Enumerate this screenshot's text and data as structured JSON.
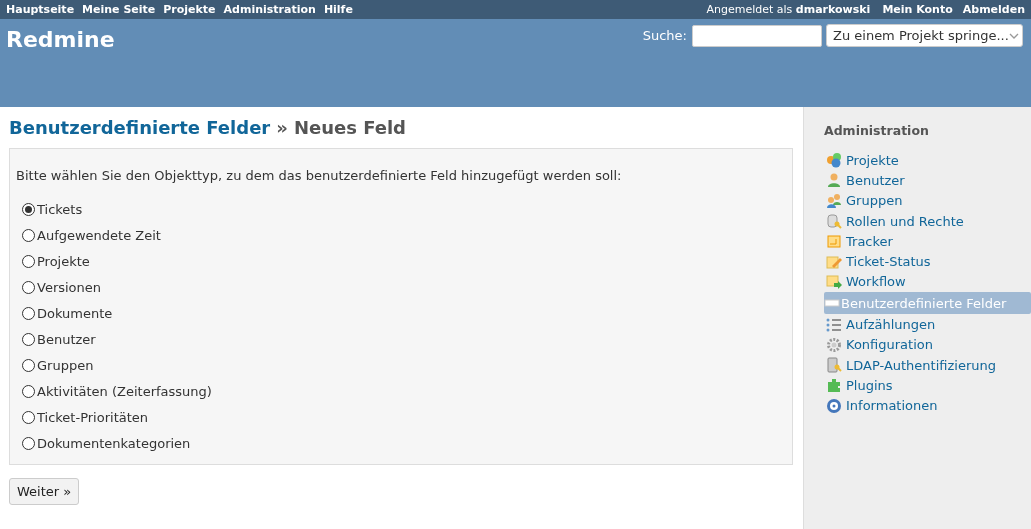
{
  "top_menu": {
    "items": [
      "Hauptseite",
      "Meine Seite",
      "Projekte",
      "Administration",
      "Hilfe"
    ],
    "logged_in": "Angemeldet als **dmarkowski**",
    "account_items": [
      "Mein Konto",
      "Abmelden"
    ]
  },
  "header": {
    "title": "Redmine",
    "search_label": "Suche:",
    "jump_placeholder": "Zu einem Projekt springe..."
  },
  "content": {
    "breadcrumb": "Benutzerdefinierte Felder",
    "separator": "»",
    "title": "Neues Feld",
    "instruction": "Bitte wählen Sie den Objekttyp, zu dem das benutzerdefinierte Feld hinzugefügt werden soll:",
    "options": [
      {
        "label": "Tickets",
        "selected": true
      },
      {
        "label": "Aufgewendete Zeit",
        "selected": false
      },
      {
        "label": "Projekte",
        "selected": false
      },
      {
        "label": "Versionen",
        "selected": false
      },
      {
        "label": "Dokumente",
        "selected": false
      },
      {
        "label": "Benutzer",
        "selected": false
      },
      {
        "label": "Gruppen",
        "selected": false
      },
      {
        "label": "Aktivitäten (Zeiterfassung)",
        "selected": false
      },
      {
        "label": "Ticket-Prioritäten",
        "selected": false
      },
      {
        "label": "Dokumentenkategorien",
        "selected": false
      }
    ],
    "button": "Weiter »"
  },
  "sidebar": {
    "title": "Administration",
    "items": [
      {
        "label": "Projekte",
        "selected": false
      },
      {
        "label": "Benutzer",
        "selected": false
      },
      {
        "label": "Gruppen",
        "selected": false
      },
      {
        "label": "Rollen und Rechte",
        "selected": false
      },
      {
        "label": "Tracker",
        "selected": false
      },
      {
        "label": "Ticket-Status",
        "selected": false
      },
      {
        "label": "Workflow",
        "selected": false
      },
      {
        "label": "Benutzerdefinierte Felder",
        "selected": true
      },
      {
        "label": "Aufzählungen",
        "selected": false
      },
      {
        "label": "Konfiguration",
        "selected": false
      },
      {
        "label": "LDAP-Authentifizierung",
        "selected": false
      },
      {
        "label": "Plugins",
        "selected": false
      },
      {
        "label": "Informationen",
        "selected": false
      }
    ]
  }
}
